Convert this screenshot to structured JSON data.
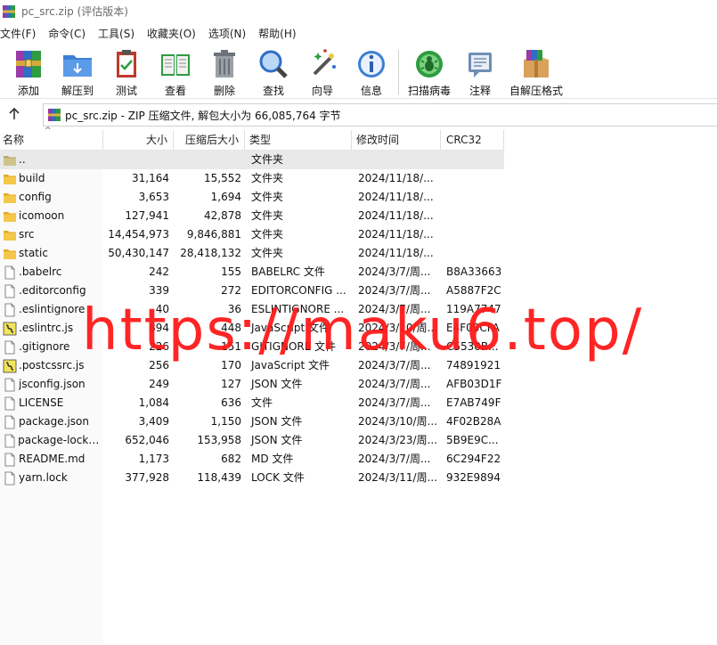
{
  "window": {
    "title": "pc_src.zip (评估版本)"
  },
  "menu": [
    "文件(F)",
    "命令(C)",
    "工具(S)",
    "收藏夹(O)",
    "选项(N)",
    "帮助(H)"
  ],
  "toolbar": {
    "add": "添加",
    "extract": "解压到",
    "test": "测试",
    "view": "查看",
    "delete": "删除",
    "find": "查找",
    "wizard": "向导",
    "info": "信息",
    "virus_scan": "扫描病毒",
    "comment": "注释",
    "sfx": "自解压格式"
  },
  "path": {
    "text": "pc_src.zip - ZIP 压缩文件, 解包大小为 66,085,764 字节"
  },
  "columns": {
    "name": "名称",
    "size": "大小",
    "packed": "压缩后大小",
    "type": "类型",
    "modified": "修改时间",
    "crc": "CRC32"
  },
  "files": [
    {
      "name": "..",
      "size": "",
      "packed": "",
      "type": "文件夹",
      "modified": "",
      "crc": "",
      "icon": "folder-up-icon"
    },
    {
      "name": "build",
      "size": "31,164",
      "packed": "15,552",
      "type": "文件夹",
      "modified": "2024/11/18/...",
      "crc": "",
      "icon": "folder-icon"
    },
    {
      "name": "config",
      "size": "3,653",
      "packed": "1,694",
      "type": "文件夹",
      "modified": "2024/11/18/...",
      "crc": "",
      "icon": "folder-icon"
    },
    {
      "name": "icomoon",
      "size": "127,941",
      "packed": "42,878",
      "type": "文件夹",
      "modified": "2024/11/18/...",
      "crc": "",
      "icon": "folder-icon"
    },
    {
      "name": "src",
      "size": "14,454,973",
      "packed": "9,846,881",
      "type": "文件夹",
      "modified": "2024/11/18/...",
      "crc": "",
      "icon": "folder-icon"
    },
    {
      "name": "static",
      "size": "50,430,147",
      "packed": "28,418,132",
      "type": "文件夹",
      "modified": "2024/11/18/...",
      "crc": "",
      "icon": "folder-icon"
    },
    {
      "name": ".babelrc",
      "size": "242",
      "packed": "155",
      "type": "BABELRC 文件",
      "modified": "2024/3/7/周...",
      "crc": "B8A33663",
      "icon": "file-icon"
    },
    {
      "name": ".editorconfig",
      "size": "339",
      "packed": "272",
      "type": "EDITORCONFIG ...",
      "modified": "2024/3/7/周...",
      "crc": "A5887F2C",
      "icon": "file-icon"
    },
    {
      "name": ".eslintignore",
      "size": "40",
      "packed": "36",
      "type": "ESLINTIGNORE ...",
      "modified": "2024/3/7/周...",
      "crc": "119A7747",
      "icon": "file-icon"
    },
    {
      "name": ".eslintrc.js",
      "size": "894",
      "packed": "448",
      "type": "JavaScript 文件",
      "modified": "2024/3/10/周...",
      "crc": "E4F00CFA",
      "icon": "js-file-icon"
    },
    {
      "name": ".gitignore",
      "size": "226",
      "packed": "151",
      "type": "GITIGNORE 文件",
      "modified": "2024/3/7/周...",
      "crc": "C5530B...",
      "icon": "file-icon"
    },
    {
      "name": ".postcssrc.js",
      "size": "256",
      "packed": "170",
      "type": "JavaScript 文件",
      "modified": "2024/3/7/周...",
      "crc": "74891921",
      "icon": "js-file-icon"
    },
    {
      "name": "jsconfig.json",
      "size": "249",
      "packed": "127",
      "type": "JSON 文件",
      "modified": "2024/3/7/周...",
      "crc": "AFB03D1F",
      "icon": "file-icon"
    },
    {
      "name": "LICENSE",
      "size": "1,084",
      "packed": "636",
      "type": "文件",
      "modified": "2024/3/7/周...",
      "crc": "E7AB749F",
      "icon": "file-icon"
    },
    {
      "name": "package.json",
      "size": "3,409",
      "packed": "1,150",
      "type": "JSON 文件",
      "modified": "2024/3/10/周...",
      "crc": "4F02B28A",
      "icon": "file-icon"
    },
    {
      "name": "package-lock.j...",
      "size": "652,046",
      "packed": "153,958",
      "type": "JSON 文件",
      "modified": "2024/3/23/周...",
      "crc": "5B9E9C...",
      "icon": "file-icon"
    },
    {
      "name": "README.md",
      "size": "1,173",
      "packed": "682",
      "type": "MD 文件",
      "modified": "2024/3/7/周...",
      "crc": "6C294F22",
      "icon": "file-icon"
    },
    {
      "name": "yarn.lock",
      "size": "377,928",
      "packed": "118,439",
      "type": "LOCK 文件",
      "modified": "2024/3/11/周...",
      "crc": "932E9894",
      "icon": "file-icon"
    }
  ],
  "watermark": {
    "text": "https://maku6.top/"
  },
  "colors": {
    "watermark": "#ff1a1a",
    "folder": "#f2c641",
    "selected_row": "#e9e9e9"
  }
}
